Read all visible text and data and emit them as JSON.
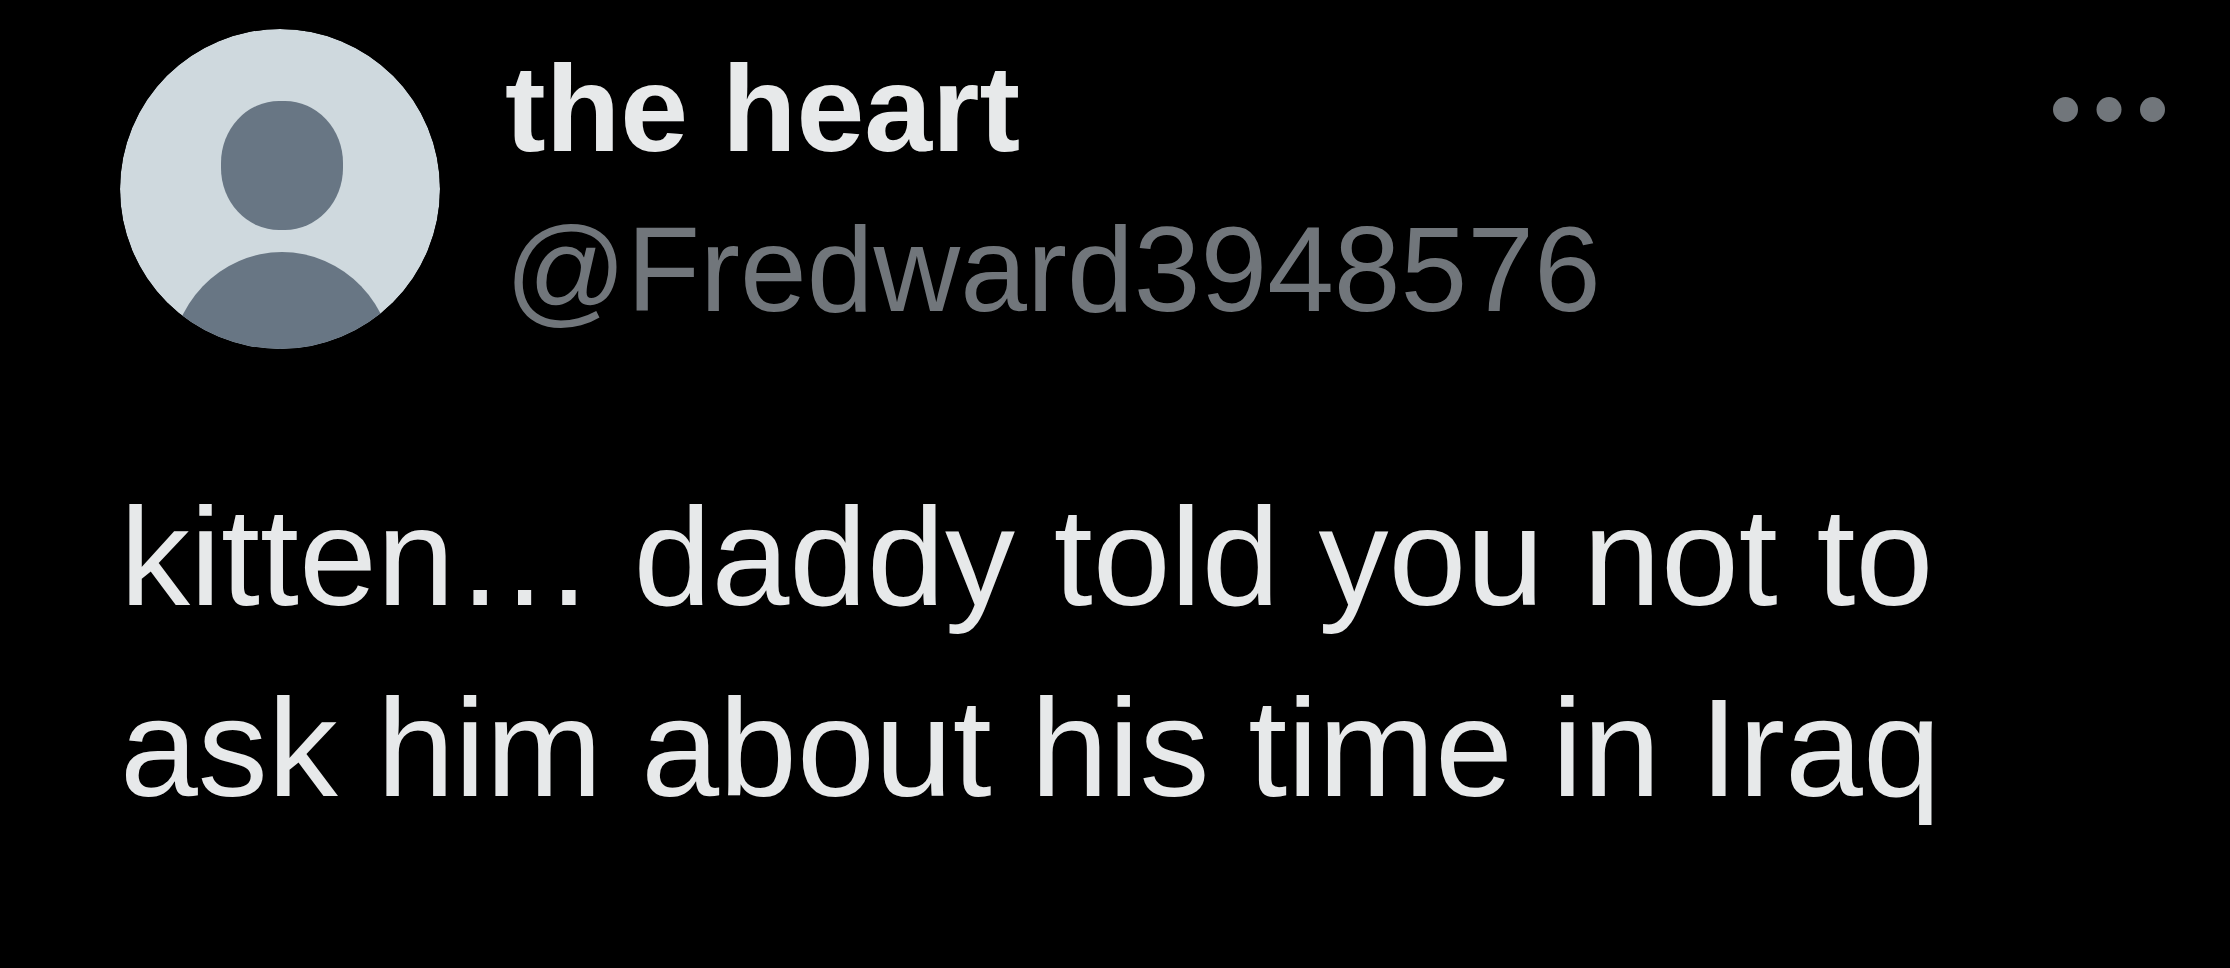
{
  "tweet": {
    "author": {
      "name": "the heart",
      "handle": "@Fredward3948576"
    },
    "text": "kitten… daddy told you not to ask him about his time in Iraq"
  }
}
